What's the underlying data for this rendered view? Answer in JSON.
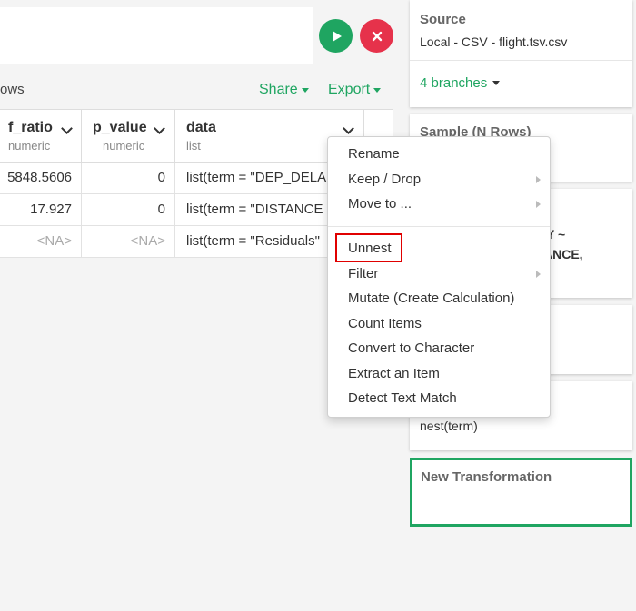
{
  "toolbar": {
    "rows_label": "ows",
    "share_label": "Share",
    "export_label": "Export"
  },
  "columns": [
    {
      "name": "f_ratio",
      "type": "numeric"
    },
    {
      "name": "p_value",
      "type": "numeric"
    },
    {
      "name": "data",
      "type": "list"
    }
  ],
  "rows": [
    {
      "f_ratio": "5848.5606",
      "p_value": "0",
      "data": "list(term = \"DEP_DELA"
    },
    {
      "f_ratio": "17.927",
      "p_value": "0",
      "data": "list(term = \"DISTANCE"
    },
    {
      "f_ratio": "<NA>",
      "p_value": "<NA>",
      "data": "list(term = \"Residuals\""
    }
  ],
  "context_menu": {
    "items": [
      "Rename",
      "Keep / Drop",
      "Move to ...",
      "Unnest",
      "Filter",
      "Mutate (Create Calculation)",
      "Count Items",
      "Convert to Character",
      "Extract an Item",
      "Detect Text Match"
    ]
  },
  "sidebar": {
    "source_title": "Source",
    "source_detail": "Local - CSV - flight.tsv.csv",
    "branches_label": "4 branches",
    "sample_title": "Sample (N Rows)",
    "step3_line1": "Y ~",
    "step3_line2": "ANCE,",
    "step5_body": "nest(term)",
    "new_transformation_label": "New Transformation"
  },
  "colors": {
    "accent_green": "#1fa561",
    "cancel_red": "#e6324b",
    "highlight_red": "#e00000"
  }
}
